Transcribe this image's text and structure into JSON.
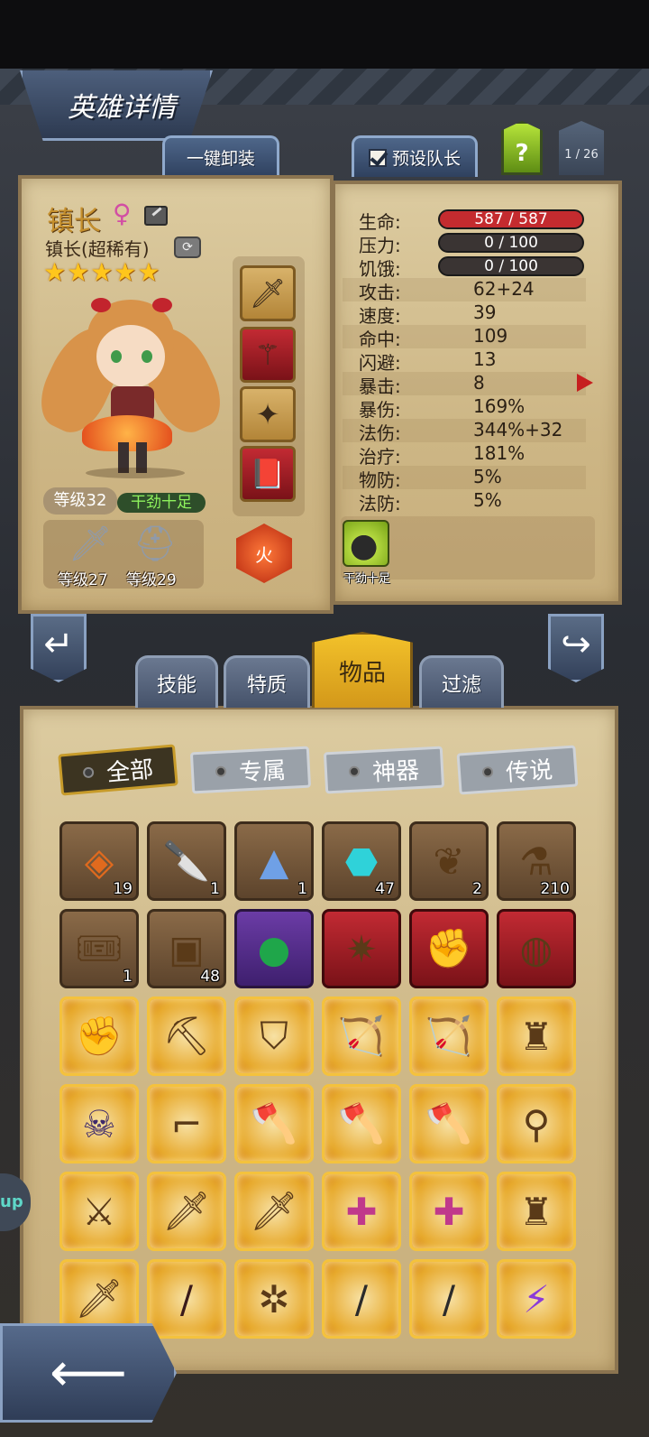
{
  "header": {
    "title": "英雄详情",
    "unequip_all": "一键卸装",
    "preset_captain": "预设队长",
    "help": "?",
    "page_counter": "1 / 26"
  },
  "hero": {
    "name": "镇长",
    "gender_symbol": "♀",
    "class": "镇长(超稀有)",
    "stars": "★★★★★",
    "level": "等级32",
    "mood": "干劲十足",
    "weapon_level": "等级27",
    "armor_level": "等级29",
    "element": "火",
    "equipment": [
      "sword-icon",
      "scepter-icon",
      "amulet-icon",
      "tome-icon"
    ]
  },
  "stats": {
    "hp": {
      "label": "生命:",
      "value": "587 / 587",
      "fill": 1.0
    },
    "stress": {
      "label": "压力:",
      "value": "0 / 100",
      "fill": 0.0
    },
    "hunger": {
      "label": "饥饿:",
      "value": "0 / 100",
      "fill": 0.0
    },
    "rows": [
      {
        "label": "攻击:",
        "value": "62+24"
      },
      {
        "label": "速度:",
        "value": "39"
      },
      {
        "label": "命中:",
        "value": "109"
      },
      {
        "label": "闪避:",
        "value": "13"
      },
      {
        "label": "暴击:",
        "value": "8"
      },
      {
        "label": "暴伤:",
        "value": "169%"
      },
      {
        "label": "法伤:",
        "value": "344%+32"
      },
      {
        "label": "治疗:",
        "value": "181%"
      },
      {
        "label": "物防:",
        "value": "5%"
      },
      {
        "label": "法防:",
        "value": "5%"
      }
    ],
    "trait_label": "干劲十足"
  },
  "tabs": {
    "skills": "技能",
    "traits": "特质",
    "items": "物品",
    "filter": "过滤"
  },
  "categories": {
    "all": "全部",
    "exclusive": "专属",
    "artifact": "神器",
    "legend": "传说"
  },
  "inventory": [
    {
      "icon": "rune-gem-icon",
      "count": "19",
      "rarity": "common"
    },
    {
      "icon": "dagger-icon",
      "count": "1",
      "rarity": "common"
    },
    {
      "icon": "crystal-pile-icon",
      "count": "1",
      "rarity": "common"
    },
    {
      "icon": "essence-stone-icon",
      "count": "47",
      "rarity": "common"
    },
    {
      "icon": "phoenix-feather-icon",
      "count": "2",
      "rarity": "common"
    },
    {
      "icon": "potion-icon",
      "count": "210",
      "rarity": "common"
    },
    {
      "icon": "ticket-icon",
      "count": "1",
      "rarity": "common"
    },
    {
      "icon": "chest-icon",
      "count": "48",
      "rarity": "common"
    },
    {
      "icon": "emerald-orb-icon",
      "count": "",
      "rarity": "epic"
    },
    {
      "icon": "star-staff-icon",
      "count": "",
      "rarity": "rare"
    },
    {
      "icon": "golden-gauntlet-icon",
      "count": "",
      "rarity": "rare"
    },
    {
      "icon": "pumpkin-ring-icon",
      "count": "",
      "rarity": "rare"
    },
    {
      "icon": "dark-gauntlet-icon",
      "count": "",
      "rarity": "legend"
    },
    {
      "icon": "pickaxe-icon",
      "count": "",
      "rarity": "legend"
    },
    {
      "icon": "shield-icon",
      "count": "",
      "rarity": "legend"
    },
    {
      "icon": "crossbow-icon",
      "count": "",
      "rarity": "legend"
    },
    {
      "icon": "dark-crossbow-icon",
      "count": "",
      "rarity": "legend"
    },
    {
      "icon": "armor-icon",
      "count": "",
      "rarity": "legend"
    },
    {
      "icon": "skull-cape-icon",
      "count": "",
      "rarity": "legend"
    },
    {
      "icon": "rifle-icon",
      "count": "",
      "rarity": "legend"
    },
    {
      "icon": "battle-axe-icon",
      "count": "",
      "rarity": "legend"
    },
    {
      "icon": "battle-axe-icon",
      "count": "",
      "rarity": "legend"
    },
    {
      "icon": "battle-axe-icon",
      "count": "",
      "rarity": "legend"
    },
    {
      "icon": "orb-staff-icon",
      "count": "",
      "rarity": "legend"
    },
    {
      "icon": "curved-blade-icon",
      "count": "",
      "rarity": "legend"
    },
    {
      "icon": "cleaver-icon",
      "count": "",
      "rarity": "legend"
    },
    {
      "icon": "cleaver-icon",
      "count": "",
      "rarity": "legend"
    },
    {
      "icon": "medkit-icon",
      "count": "",
      "rarity": "legend"
    },
    {
      "icon": "medkit-icon",
      "count": "",
      "rarity": "legend"
    },
    {
      "icon": "spiked-armor-icon",
      "count": "",
      "rarity": "legend"
    },
    {
      "icon": "short-sword-icon",
      "count": "",
      "rarity": "legend"
    },
    {
      "icon": "katana-icon",
      "count": "",
      "rarity": "legend"
    },
    {
      "icon": "spellbook-icon",
      "count": "",
      "rarity": "legend"
    },
    {
      "icon": "staff-icon",
      "count": "",
      "rarity": "legend"
    },
    {
      "icon": "staff-icon",
      "count": "",
      "rarity": "legend"
    },
    {
      "icon": "void-blade-icon",
      "count": "",
      "rarity": "legend"
    }
  ],
  "side_tab": "up"
}
